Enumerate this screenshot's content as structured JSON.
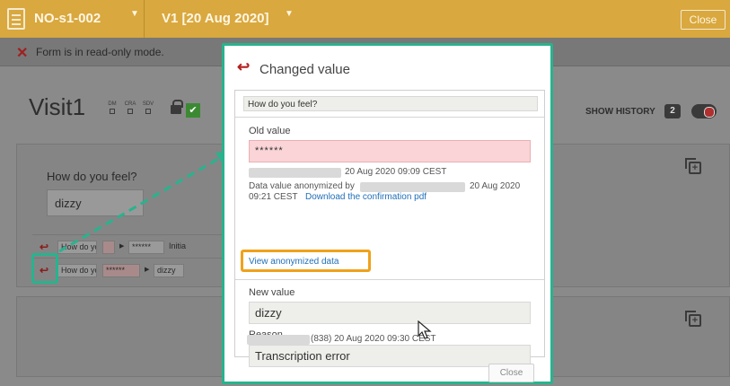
{
  "topbar": {
    "form_name": "NO-s1-002",
    "version": "V1 [20 Aug 2020]",
    "close_label": "Close"
  },
  "readonly_notice": "Form is in read-only mode.",
  "visit": {
    "title": "Visit1",
    "flags": [
      "DM",
      "CRA",
      "SDV"
    ],
    "show_history_label": "SHOW HISTORY",
    "history_count": "2"
  },
  "question": {
    "label": "How do you feel?",
    "answer": "dizzy"
  },
  "history_rows": [
    {
      "question": "How do you",
      "old": "",
      "new": "******",
      "tail": "Initia"
    },
    {
      "question": "How do you",
      "old": "******",
      "new": "dizzy",
      "tail": ""
    }
  ],
  "modal": {
    "title": "Changed value",
    "question": "How do you feel?",
    "old_value_label": "Old value",
    "old_value": "******",
    "old_date": "20 Aug 2020 09:09 CEST",
    "anonymized_by_prefix": "Data value anonymized by",
    "anonymized_date": "20 Aug 2020",
    "anonymized_time": "09:21 CEST",
    "download_link": "Download the confirmation pdf",
    "view_anonymized": "View anonymized data",
    "new_value_label": "New value",
    "new_value": "dizzy",
    "reason_label": "Reason",
    "reason": "Transcription error",
    "reason_meta": "(838) 20 Aug 2020 09:30 CEST",
    "close_label": "Close"
  },
  "colors": {
    "topbar": "#d9a83e",
    "highlight_green": "#28b38e",
    "highlight_orange": "#f0a11a",
    "old_value_bg": "#fad4d7",
    "link": "#1f6fb8"
  }
}
